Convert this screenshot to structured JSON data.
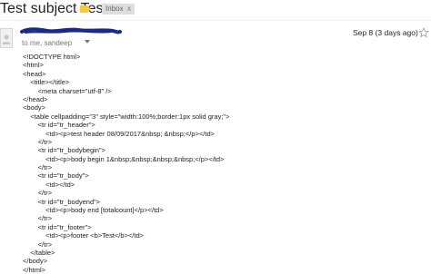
{
  "header": {
    "subject": "Test subject Test",
    "label": "Inbox",
    "label_close": "x"
  },
  "message": {
    "to_line": "to me, sandeep",
    "date": "Sep 8 (3 days ago)"
  },
  "body_lines": [
    "<!DOCTYPE html>",
    "<html>",
    "<head>",
    "    <title></title>",
    "        <meta charset=\"utf-8\" />",
    "</head>",
    "<body>",
    "    <table cellpadding=\"3\" style=\"width:100%;border:1px solid gray;\">",
    "        <tr id=\"tr_header\">",
    "            <td><p>test header 08/09/2017&nbsp; &nbsp;</p></td>",
    "        </tr>",
    "        <tr id=\"tr_bodybegin\">",
    "            <td><p>body begin 1&nbsp;&nbsp;&nbsp;&nbsp;</p></td>",
    "        </tr>",
    "        <tr id=\"tr_body\">",
    "            <td></td>",
    "        </tr>",
    "        <tr id=\"tr_bodyend\">",
    "            <td><p>body end [totalcount]</p></td>",
    "        </tr>",
    "        <tr id=\"tr_footer\">",
    "            <td><p>footer <b>Test</b></td>",
    "        </tr>",
    "    </table>",
    "</body>",
    "</html>"
  ],
  "colors": {
    "important_marker": "#f4c842",
    "label_bg": "#dddddd",
    "redaction": "#1a2a8a"
  }
}
